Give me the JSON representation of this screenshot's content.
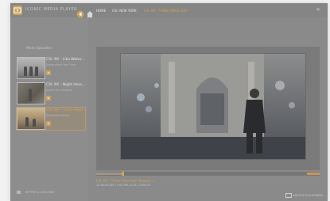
{
  "app": {
    "title": "ICONIC MEDIA PLAYER"
  },
  "breadcrumb": {
    "home": "HOME",
    "show": "CSI: NEW YORK",
    "episode": "CSI: NY - THREE PIECE SUIT"
  },
  "sidebar": {
    "heading": "More Episodes",
    "episodes": [
      {
        "title": "CSI: NY - Like Water...",
        "sub": "Some other text here",
        "sub2": "",
        "selected": false
      },
      {
        "title": "CSI: NY - Night Hero...",
        "sub": "Who's this episode",
        "sub2": "",
        "selected": false
      },
      {
        "title": "CSI: NY - Three Piece...",
        "sub": "Some text about",
        "sub2": "",
        "selected": true
      }
    ],
    "footer": "REPORT A CONCERN"
  },
  "player": {
    "progress": 0.12,
    "now_title": "CSI: NY - Three Piece Suit (Season...)",
    "now_meta": "12:00:00 AM | 7:00 PM | 0:01 / 0:00:00",
    "fullscreen_label": "SWITCH FULLSCREEN"
  },
  "colors": {
    "accent": "#d7a355"
  },
  "icons": {
    "logo": "app-logo-icon",
    "back": "back-arrow-icon",
    "home": "home-icon",
    "close": "close-icon"
  }
}
